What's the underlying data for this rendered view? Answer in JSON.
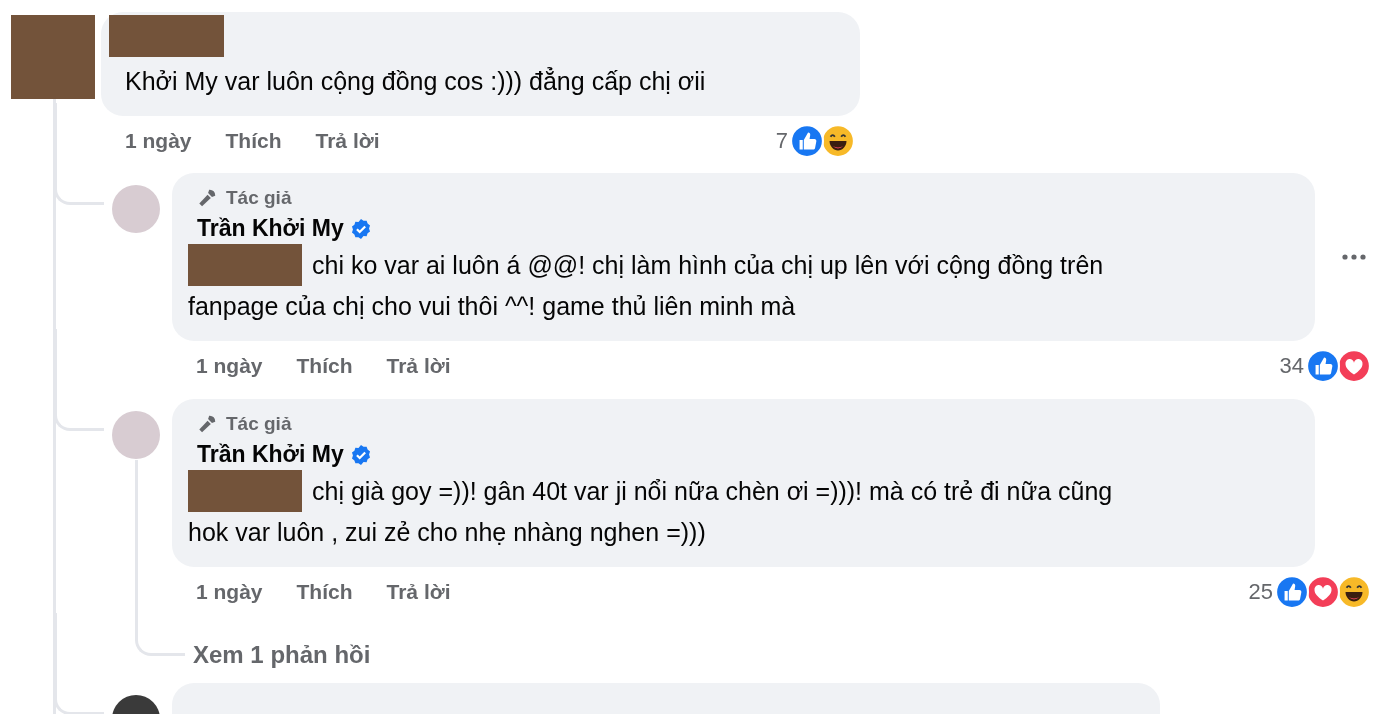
{
  "comment": {
    "text": "Khởi My var luôn cộng đồng cos :))) đẳng cấp chị ơii",
    "time": "1 ngày",
    "like": "Thích",
    "reply": "Trả lời",
    "reaction_count": "7",
    "reactions": [
      {
        "kind": "like"
      },
      {
        "kind": "haha"
      }
    ]
  },
  "replies": [
    {
      "badge": "Tác giả",
      "author": "Trần Khởi My",
      "verified": true,
      "mention_redacted": true,
      "text_lines": [
        "chi ko var ai luôn á @@! chị làm hình của chị up lên với cộng đồng trên",
        "fanpage của chị cho vui thôi ^^! game thủ liên minh mà"
      ],
      "show_menu": true,
      "time": "1 ngày",
      "like": "Thích",
      "reply": "Trả lời",
      "reaction_count": "34",
      "reactions": [
        {
          "kind": "like"
        },
        {
          "kind": "love"
        }
      ]
    },
    {
      "badge": "Tác giả",
      "author": "Trần Khởi My",
      "verified": true,
      "mention_redacted": true,
      "text_lines": [
        "chị già goy =))! gân 40t var ji nổi nữa chèn ơi =)))! mà có trẻ đi nữa cũng",
        "hok var luôn , zui zẻ cho nhẹ nhàng nghen =)))"
      ],
      "show_menu": false,
      "time": "1 ngày",
      "like": "Thích",
      "reply": "Trả lời",
      "reaction_count": "25",
      "reactions": [
        {
          "kind": "like"
        },
        {
          "kind": "love"
        },
        {
          "kind": "haha"
        }
      ],
      "view_replies": "Xem 1 phản hồi"
    }
  ]
}
